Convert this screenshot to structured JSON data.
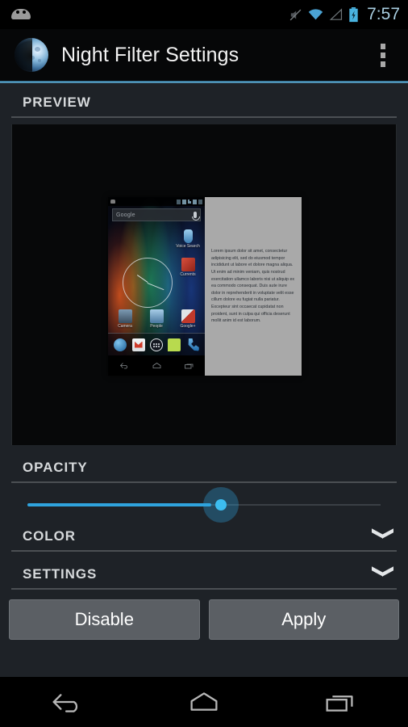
{
  "status_bar": {
    "notification_icon": "android-robot-icon",
    "icons": [
      "mute-icon",
      "wifi-icon",
      "signal-icon",
      "battery-charging-icon"
    ],
    "time": "7:57",
    "time_color": "#a8cde0"
  },
  "action_bar": {
    "app_icon": "moon-icon",
    "title": "Night Filter Settings",
    "overflow_label": "overflow-menu-icon",
    "accent_color": "#4d9fca"
  },
  "sections": {
    "preview": {
      "title": "PREVIEW"
    },
    "opacity": {
      "title": "OPACITY"
    },
    "color": {
      "title": "COLOR",
      "chevron": "chevron-down-icon"
    },
    "settings": {
      "title": "SETTINGS",
      "chevron": "chevron-down-icon"
    }
  },
  "preview": {
    "home_screen": {
      "status_icons": [
        "notification-icon",
        "bluetooth-icon",
        "wifi-icon",
        "signal-icon",
        "battery-icon",
        "alarm-icon"
      ],
      "search_placeholder": "Google",
      "mic_icon": "microphone-icon",
      "clock_widget": "analog-clock-widget",
      "apps": [
        {
          "label": "Voice Search",
          "icon": "voice-search-icon",
          "color": "#5b9fd4"
        },
        {
          "label": "Currents",
          "icon": "currents-icon",
          "color": "#c0392b"
        },
        {
          "label": "Camera",
          "icon": "camera-icon",
          "color": "#5d7a96"
        },
        {
          "label": "People",
          "icon": "people-icon",
          "color": "#7fa8c4"
        },
        {
          "label": "Google+",
          "icon": "google-plus-icon",
          "color": "#b03b2e"
        }
      ],
      "dock": [
        {
          "icon": "browser-icon",
          "color": "#2e74b5"
        },
        {
          "icon": "gmail-icon",
          "color": "#eceff1"
        },
        {
          "icon": "app-drawer-icon",
          "color": "#2b2f36"
        },
        {
          "icon": "messaging-icon",
          "color": "#b6d84a"
        },
        {
          "icon": "phone-icon",
          "color": "#2f7fc4"
        }
      ],
      "nav": [
        "back-icon",
        "home-icon",
        "recents-icon"
      ]
    },
    "filtered_panel": {
      "text": "Lorem ipsum dolor sit amet, consectetur adipisicing elit, sed do eiusmod tempor incididunt ut labore et dolore magna aliqua. Ut enim ad minim veniam, quis nostrud exercitation ullamco laboris nisi ut aliquip ex ea commodo consequat. Duis aute irure dolor in reprehenderit in voluptate velit esse cillum dolore eu fugiat nulla pariatur. Excepteur sint occaecat cupidatat non proident, sunt in culpa qui officia deserunt mollit anim id est laborum.",
      "background": "#a9a9a9"
    }
  },
  "opacity_slider": {
    "fill_color": "#2fa3dd",
    "thumb_color": "#3cbdf0",
    "track_color": "#3a3f45"
  },
  "buttons": {
    "disable": "Disable",
    "apply": "Apply"
  },
  "nav_bar": {
    "back": "back-icon",
    "home": "home-icon",
    "recents": "recents-icon"
  }
}
